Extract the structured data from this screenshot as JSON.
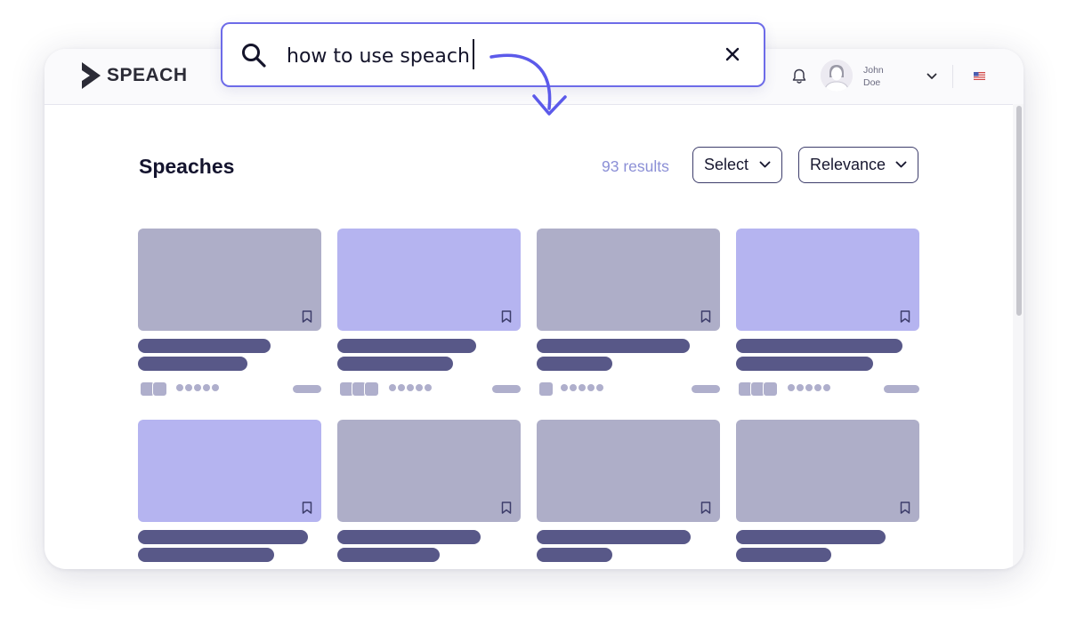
{
  "app": {
    "logo_text": "SPEACH"
  },
  "search": {
    "value": "how to use speach",
    "placeholder": ""
  },
  "header": {
    "user": {
      "first_name": "John",
      "last_name": "Doe"
    },
    "icons": [
      "bell-icon",
      "chevron-down-icon",
      "us-flag-icon"
    ]
  },
  "page": {
    "title": "Speaches",
    "results_text": "93 results",
    "filters": {
      "select_label": "Select",
      "sort_label": "Relevance"
    }
  },
  "colors": {
    "accent": "#6d6be8",
    "thumb_gray": "#aeaec8",
    "thumb_lavender": "#b5b4f0",
    "bar": "#585888",
    "results_text": "#8b8fd6"
  }
}
